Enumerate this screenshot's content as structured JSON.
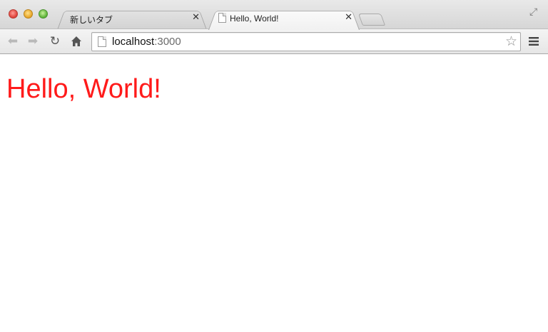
{
  "browser": {
    "tabs": [
      {
        "label": "新しいタブ",
        "active": false
      },
      {
        "label": "Hello, World!",
        "active": true
      }
    ],
    "address_bar": {
      "host": "localhost",
      "port": ":3000"
    },
    "icons": {
      "back": "back-arrow-icon",
      "forward": "forward-arrow-icon",
      "reload": "reload-icon",
      "home": "home-icon",
      "bookmark": "star-icon",
      "menu": "hamburger-menu-icon",
      "fullscreen": "fullscreen-icon"
    }
  },
  "page": {
    "heading": "Hello, World!",
    "heading_color": "#ff1a1a"
  }
}
